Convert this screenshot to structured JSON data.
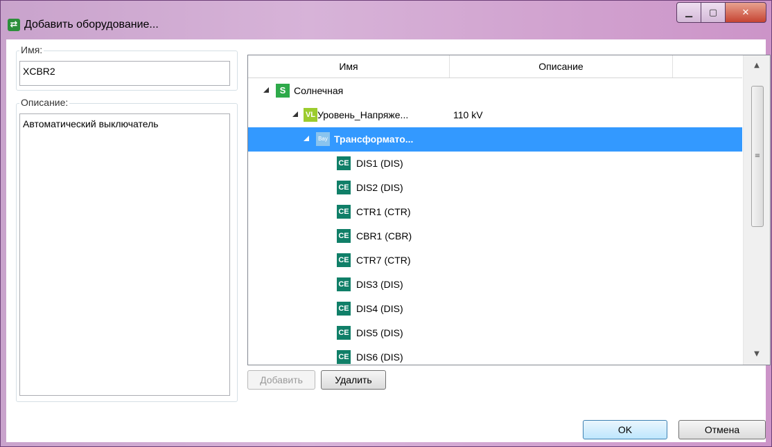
{
  "window": {
    "title": "Добавить оборудование...",
    "icon": "app-icon"
  },
  "left": {
    "name_legend": "Имя:",
    "name_value": "XCBR2",
    "desc_legend": "Описание:",
    "desc_value": "Автоматический выключатель"
  },
  "grid": {
    "columns": [
      "Имя",
      "Описание"
    ],
    "rows": [
      {
        "badge": "S",
        "label": "Солнечная",
        "desc": ""
      },
      {
        "badge": "VL",
        "label": "Уровень_Напряже...",
        "desc": "110 kV"
      },
      {
        "badge": "Bay",
        "label": "Трансформато...",
        "desc": ""
      },
      {
        "badge": "CE",
        "label": "DIS1 (DIS)",
        "desc": ""
      },
      {
        "badge": "CE",
        "label": "DIS2 (DIS)",
        "desc": ""
      },
      {
        "badge": "CE",
        "label": "CTR1 (CTR)",
        "desc": ""
      },
      {
        "badge": "CE",
        "label": "CBR1 (CBR)",
        "desc": ""
      },
      {
        "badge": "CE",
        "label": "CTR7 (CTR)",
        "desc": ""
      },
      {
        "badge": "CE",
        "label": "DIS3 (DIS)",
        "desc": ""
      },
      {
        "badge": "CE",
        "label": "DIS4 (DIS)",
        "desc": ""
      },
      {
        "badge": "CE",
        "label": "DIS5 (DIS)",
        "desc": ""
      },
      {
        "badge": "CE",
        "label": "DIS6 (DIS)",
        "desc": ""
      }
    ]
  },
  "buttons": {
    "add": "Добавить",
    "remove": "Удалить",
    "ok": "OK",
    "cancel": "Отмена"
  },
  "colors": {
    "selection": "#3399ff",
    "ce_badge": "#107f68",
    "s_badge": "#2eaa4a",
    "vl_badge": "#9ccc2e",
    "bay_badge": "#8ac4ee"
  }
}
